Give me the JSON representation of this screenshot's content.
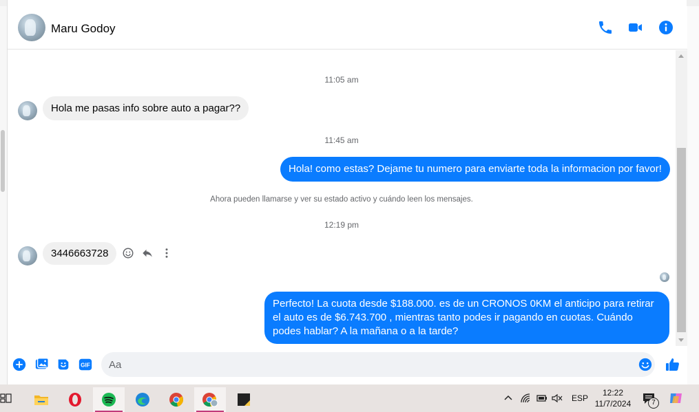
{
  "contact": {
    "name": "Maru Godoy"
  },
  "header": {
    "icons": [
      "phone-icon",
      "video-camera-icon",
      "info-icon"
    ]
  },
  "colors": {
    "accent": "#0a7cff",
    "incoming_bubble": "#f0f0f0"
  },
  "messages": {
    "t1": "11:05 am",
    "m1": "Hola me pasas info sobre auto a pagar??",
    "t2": "11:45 am",
    "m2": "Hola! como estas? Dejame tu numero para enviarte toda la informacion por favor!",
    "notice": "Ahora pueden llamarse y ver su estado activo y cuándo leen los mensajes.",
    "t3": "12:19 pm",
    "m3": "3446663728",
    "m4": "Perfecto! La cuota desde $188.000. es de un CRONOS 0KM el anticipo para retirar el auto es de $6.743.700 , mientras tanto podes ir pagando en cuotas. Cuándo podes hablar? A la mañana o a la tarde?"
  },
  "composer": {
    "placeholder": "Aa"
  },
  "taskbar": {
    "lang": "ESP",
    "time": "12:22",
    "date": "11/7/2024",
    "notification_count": "7"
  }
}
